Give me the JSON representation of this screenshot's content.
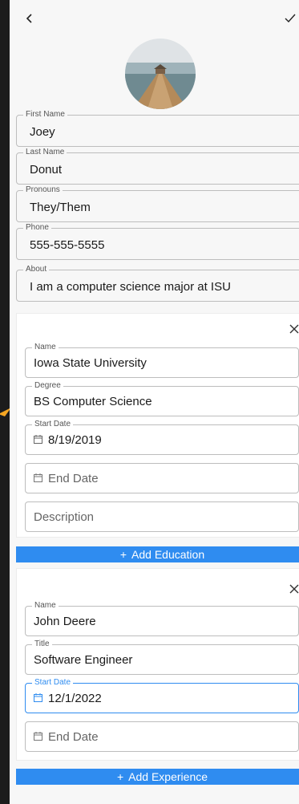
{
  "header": {
    "back_icon": "chevron-left-icon",
    "save_icon": "checkmark-icon"
  },
  "profile": {
    "avatar_alt": "pier-photo",
    "fields": [
      {
        "label": "First Name",
        "value": "Joey"
      },
      {
        "label": "Last Name",
        "value": "Donut"
      },
      {
        "label": "Pronouns",
        "value": "They/Them"
      },
      {
        "label": "Phone",
        "value": "555-555-5555"
      },
      {
        "label": "About",
        "value": "I am a computer science major at ISU"
      }
    ]
  },
  "education": {
    "name": {
      "label": "Name",
      "value": "Iowa State University"
    },
    "degree": {
      "label": "Degree",
      "value": "BS Computer Science"
    },
    "start_date": {
      "label": "Start Date",
      "value": "8/19/2019"
    },
    "end_date": {
      "placeholder": "End Date"
    },
    "description": {
      "placeholder": "Description"
    },
    "add_label": "Add Education"
  },
  "experience": {
    "name": {
      "label": "Name",
      "value": "John Deere"
    },
    "title": {
      "label": "Title",
      "value": "Software Engineer"
    },
    "start_date": {
      "label": "Start Date",
      "value": "12/1/2022"
    },
    "end_date": {
      "placeholder": "End Date"
    },
    "add_label": "Add Experience"
  },
  "colors": {
    "accent": "#2f8cf0",
    "background": "#f7f7f7",
    "outer": "#1c1c1c",
    "arrow": "#f5a623"
  }
}
